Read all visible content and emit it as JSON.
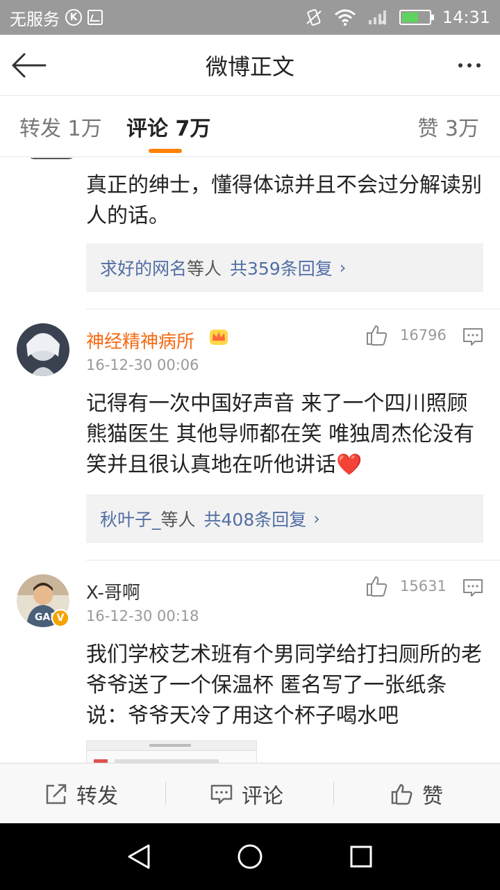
{
  "status_bar": {
    "carrier": "无服务",
    "time": "14:31",
    "battery_level": 0.65
  },
  "header": {
    "title": "微博正文"
  },
  "tabs": {
    "forward": "转发 1万",
    "comments": "评论 7万",
    "likes": "赞 3万",
    "active": "comments"
  },
  "comments": [
    {
      "text": "真正的绅士，懂得体谅并且不会过分解读别人的话。",
      "replies": {
        "names": "求好的网名",
        "mid": "等人",
        "count": "共359条回复",
        "arrow": "›"
      }
    },
    {
      "username": "神经精神病所",
      "time": "16-12-30 00:06",
      "likes": "16796",
      "text": "记得有一次中国好声音 来了一个四川照顾熊猫医生 其他导师都在笑 唯独周杰伦没有笑并且很认真地在听他讲话❤️",
      "replies": {
        "names": "秋叶子_",
        "mid": "等人",
        "count": "共408条回复",
        "arrow": "›"
      }
    },
    {
      "username": "X-哥啊",
      "time": "16-12-30 00:18",
      "likes": "15631",
      "text": "我们学校艺术班有个男同学给打扫厕所的老爷爷送了一个保温杯 匿名写了一张纸条说：爷爷天冷了用这个杯子喝水吧"
    }
  ],
  "action_bar": {
    "forward": "转发",
    "comment": "评论",
    "like": "赞"
  },
  "colors": {
    "accent": "#ff8200",
    "username_orange": "#f66a12",
    "link_blue": "#526ea4",
    "status_bar": "#9a9a9a"
  }
}
